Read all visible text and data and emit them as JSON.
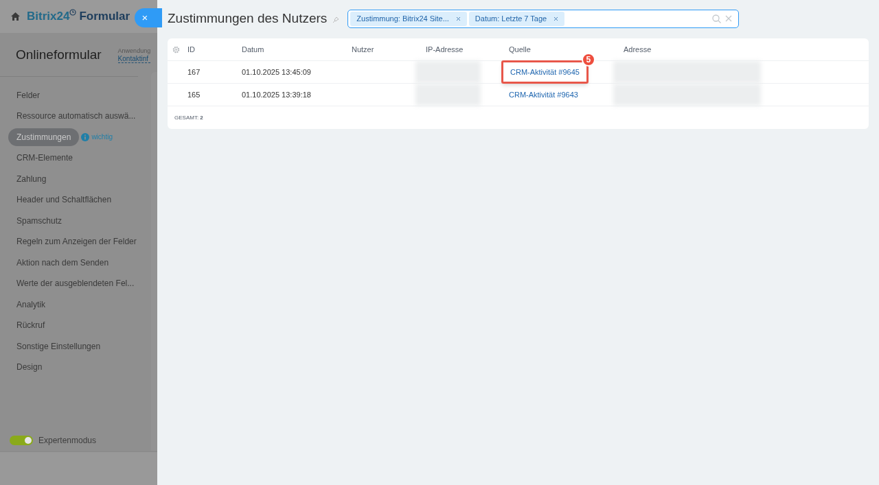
{
  "background_app": {
    "header": {
      "title_brand": "Bitrix24",
      "title_rest": "Formular"
    },
    "page_title": "Onlineformular",
    "application": {
      "label": "Anwendung",
      "value": "Kontaktinf"
    },
    "sidebar": {
      "items": [
        {
          "label": "Felder",
          "selected": false
        },
        {
          "label": "Ressource automatisch auswä...",
          "selected": false
        },
        {
          "label": "Zustimmungen",
          "selected": true,
          "hint": "wichtig"
        },
        {
          "label": "CRM-Elemente",
          "selected": false
        },
        {
          "label": "Zahlung",
          "selected": false
        },
        {
          "label": "Header und Schaltflächen",
          "selected": false
        },
        {
          "label": "Spamschutz",
          "selected": false
        },
        {
          "label": "Regeln zum Anzeigen der Felder",
          "selected": false
        },
        {
          "label": "Aktion nach dem Senden",
          "selected": false
        },
        {
          "label": "Werte der ausgeblendeten Fel...",
          "selected": false
        },
        {
          "label": "Analytik",
          "selected": false
        },
        {
          "label": "Rückruf",
          "selected": false
        },
        {
          "label": "Sonstige Einstellungen",
          "selected": false
        },
        {
          "label": "Design",
          "selected": false
        }
      ]
    },
    "expert_mode": {
      "label": "Expertenmodus",
      "on": true
    }
  },
  "slider": {
    "close_label": "×",
    "title": "Zustimmungen des Nutzers",
    "filter": {
      "tags": [
        "Zustimmung: Bitrix24 Site...",
        "Datum: Letzte 7 Tage"
      ]
    },
    "table": {
      "columns": [
        "ID",
        "Datum",
        "Nutzer",
        "IP-Adresse",
        "Quelle",
        "Adresse"
      ],
      "rows": [
        {
          "id": "167",
          "datum": "01.10.2025 13:45:09",
          "quelle": "CRM-Aktivität #9645",
          "highlighted": true,
          "marker": "5"
        },
        {
          "id": "165",
          "datum": "01.10.2025 13:39:18",
          "quelle": "CRM-Aktivität #9643",
          "highlighted": false
        }
      ],
      "total_label": "GESAMT:",
      "total": "2"
    }
  }
}
